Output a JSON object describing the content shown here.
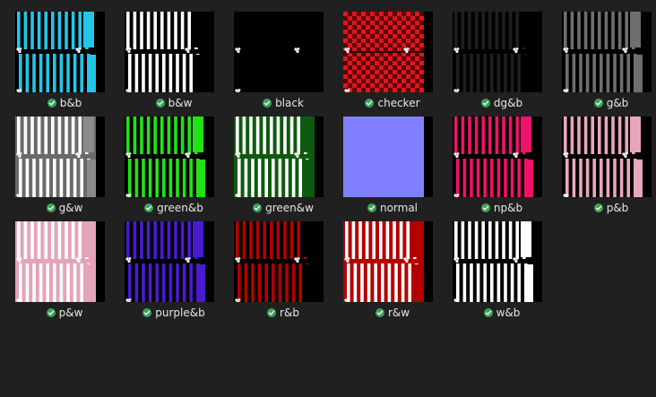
{
  "folder": {
    "items": [
      {
        "name": "b&b",
        "theme": "stripes",
        "bg": "#000000",
        "fg": "#22c6e8",
        "accent": "#22c6e8",
        "status": "synced-check-icon"
      },
      {
        "name": "b&w",
        "theme": "stripes",
        "bg": "#000000",
        "fg": "#ffffff",
        "accent": "#000000",
        "status": "synced-check-icon"
      },
      {
        "name": "black",
        "theme": "solid",
        "bg": "#000000",
        "fg": "#ffffff",
        "accent": "#000000",
        "status": "synced-check-icon"
      },
      {
        "name": "checker",
        "theme": "checker",
        "bg": "#5a0000",
        "fg": "#e0141e",
        "accent": "#5a0000",
        "status": "synced-check-icon"
      },
      {
        "name": "dg&b",
        "theme": "stripes",
        "bg": "#000000",
        "fg": "#1e1e1e",
        "accent": "#000000",
        "status": "synced-check-icon"
      },
      {
        "name": "g&b",
        "theme": "stripes",
        "bg": "#000000",
        "fg": "#6e6e6e",
        "accent": "#6e6e6e",
        "status": "synced-check-icon"
      },
      {
        "name": "g&w",
        "theme": "stripes",
        "bg": "#6a6a6a",
        "fg": "#ffffff",
        "accent": "#8a8a8a",
        "status": "synced-check-icon"
      },
      {
        "name": "green&b",
        "theme": "stripes",
        "bg": "#000000",
        "fg": "#22e214",
        "accent": "#22e214",
        "status": "synced-check-icon"
      },
      {
        "name": "green&w",
        "theme": "stripes",
        "bg": "#0e5a10",
        "fg": "#ffffff",
        "accent": "#0e5a10",
        "status": "synced-check-icon"
      },
      {
        "name": "normal",
        "theme": "solid",
        "bg": "#8080ff",
        "fg": "#8585ff",
        "accent": "#8080ff",
        "status": "synced-check-icon"
      },
      {
        "name": "np&b",
        "theme": "stripes",
        "bg": "#000000",
        "fg": "#f0116a",
        "accent": "#f0116a",
        "status": "synced-check-icon"
      },
      {
        "name": "p&b",
        "theme": "stripes",
        "bg": "#000000",
        "fg": "#e8a6bd",
        "accent": "#e8a6bd",
        "status": "synced-check-icon"
      },
      {
        "name": "p&w",
        "theme": "stripes",
        "bg": "#e5a3b9",
        "fg": "#ffffff",
        "accent": "#e5a3b9",
        "status": "synced-check-icon"
      },
      {
        "name": "purple&b",
        "theme": "stripes",
        "bg": "#000000",
        "fg": "#4a1ad0",
        "accent": "#4a1ad0",
        "status": "synced-check-icon"
      },
      {
        "name": "r&b",
        "theme": "stripes",
        "bg": "#000000",
        "fg": "#b40000",
        "accent": "#000000",
        "status": "synced-check-icon"
      },
      {
        "name": "r&w",
        "theme": "stripes",
        "bg": "#b40000",
        "fg": "#ffffff",
        "accent": "#b40000",
        "status": "synced-check-icon"
      },
      {
        "name": "w&b",
        "theme": "stripes",
        "bg": "#000000",
        "fg": "#ffffff",
        "accent": "#ffffff",
        "status": "synced-check-icon"
      }
    ]
  }
}
